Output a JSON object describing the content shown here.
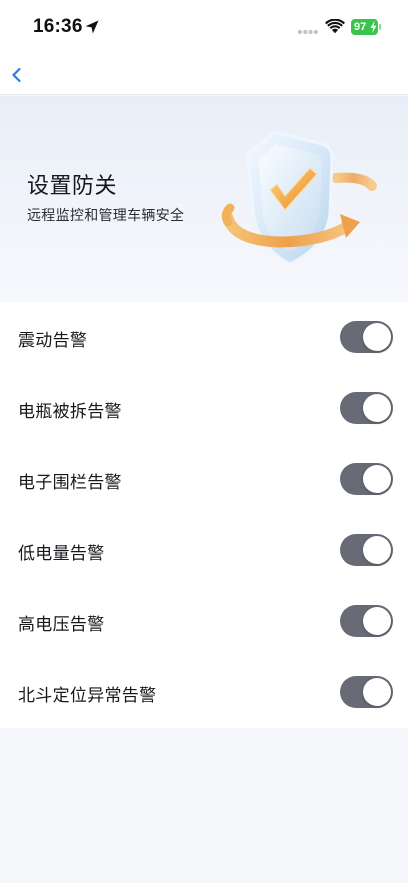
{
  "status_bar": {
    "time": "16:36",
    "battery": "97"
  },
  "nav": {
    "back_icon": "chevron-left-icon"
  },
  "banner": {
    "title": "设置防关",
    "subtitle": "远程监控和管理车辆安全"
  },
  "alerts": [
    {
      "label": "震动告警",
      "enabled": true
    },
    {
      "label": "电瓶被拆告警",
      "enabled": true
    },
    {
      "label": "电子围栏告警",
      "enabled": true
    },
    {
      "label": "低电量告警",
      "enabled": true
    },
    {
      "label": "高电压告警",
      "enabled": true
    },
    {
      "label": "北斗定位异常告警",
      "enabled": true
    }
  ],
  "colors": {
    "accent": "#2b7de0",
    "toggle_on": "#686a75",
    "battery": "#3bc44b",
    "shield_check": "#f0a640"
  }
}
